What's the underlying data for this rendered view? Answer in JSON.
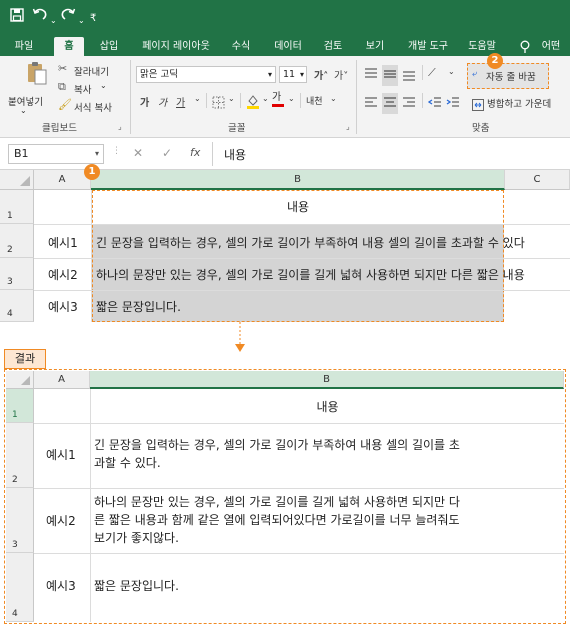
{
  "quick_access": {
    "save_icon": "save-icon",
    "undo_icon": "undo-icon",
    "redo_icon": "redo-icon",
    "customize_icon": "customize-icon"
  },
  "tabs": [
    "파일",
    "홈",
    "삽입",
    "페이지 레이아웃",
    "수식",
    "데이터",
    "검토",
    "보기",
    "개발 도구",
    "도움말",
    "어떤"
  ],
  "active_tab": "홈",
  "ribbon": {
    "clipboard": {
      "paste": "붙여넣기",
      "cut": "잘라내기",
      "copy": "복사",
      "format_painter": "서식 복사",
      "label": "클립보드"
    },
    "font": {
      "name": "맑은 고딕",
      "size": "11",
      "label": "글꼴",
      "phonetic": "내천"
    },
    "alignment": {
      "wrap_text": "자동 줄 바꿈",
      "merge": "병합하고 가운데",
      "label": "맞춤"
    }
  },
  "formula_bar": {
    "name_box": "B1",
    "fx": "fx",
    "content": "내용"
  },
  "badges": {
    "one": "1",
    "two": "2"
  },
  "top_grid": {
    "columns": [
      "A",
      "B",
      "C"
    ],
    "rows": [
      {
        "num": "1",
        "a": "",
        "b": "내용"
      },
      {
        "num": "2",
        "a": "예시1",
        "b": "긴 문장을 입력하는 경우, 셀의 가로 길이가 부족하여 내용 셀의 길이를 초과할 수 있다"
      },
      {
        "num": "3",
        "a": "예시2",
        "b": "하나의 문장만 있는 경우, 셀의 가로 길이를 길게 넓혀 사용하면 되지만 다른 짧은 내용"
      },
      {
        "num": "4",
        "a": "예시3",
        "b": "짧은 문장입니다."
      }
    ]
  },
  "result": {
    "label": "결과",
    "columns": [
      "A",
      "B"
    ],
    "rows": [
      {
        "num": "1",
        "a": "",
        "b": "내용"
      },
      {
        "num": "2",
        "a": "예시1",
        "b_lines": [
          "긴 문장을 입력하는 경우, 셀의 가로 길이가 부족하여 내용 셀의 길이를 초",
          "과할 수 있다."
        ]
      },
      {
        "num": "3",
        "a": "예시2",
        "b_lines": [
          "하나의 문장만 있는 경우, 셀의 가로 길이를 길게 넓혀 사용하면 되지만 다",
          "른 짧은 내용과 함께 같은 열에 입력되어있다면 가로길이를 너무 늘려줘도",
          "보기가 좋지않다."
        ]
      },
      {
        "num": "4",
        "a": "예시3",
        "b": "짧은 문장입니다."
      }
    ]
  },
  "colors": {
    "excel_green": "#217346",
    "accent_orange": "#f08a24"
  }
}
